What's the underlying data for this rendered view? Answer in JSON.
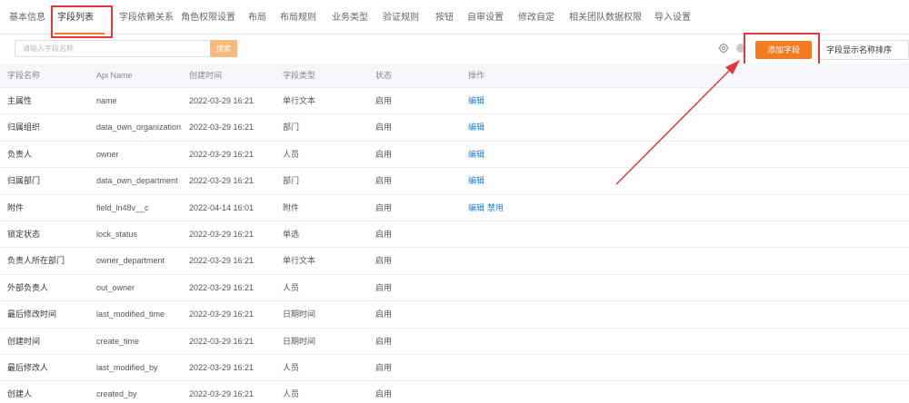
{
  "tabs": [
    {
      "label": "基本信息"
    },
    {
      "label": "字段列表"
    },
    {
      "label": "字段依赖关系"
    },
    {
      "label": "角色权限设置"
    },
    {
      "label": "布局"
    },
    {
      "label": "布局规则"
    },
    {
      "label": "业务类型"
    },
    {
      "label": "验证规则"
    },
    {
      "label": "按钮"
    },
    {
      "label": "自审设置"
    },
    {
      "label": "修改自定"
    },
    {
      "label": "相关团队数据权限"
    },
    {
      "label": "导入设置"
    }
  ],
  "active_tab": "字段列表",
  "toolbar": {
    "search_placeholder": "请输入字段名称",
    "search_button": "搜索",
    "add_field_button": "添加字段",
    "sort_button": "字段显示名称排序"
  },
  "icons": {
    "settings": "gear-icon",
    "info": "info-icon"
  },
  "colors": {
    "accent": "#f47b20",
    "link": "#1f7fd6",
    "annotation": "#e03a3a"
  },
  "table": {
    "headers": [
      "字段名称",
      "Api Name",
      "创建时间",
      "字段类型",
      "状态",
      "操作"
    ],
    "rows": [
      {
        "name": "主属性",
        "api": "name",
        "created": "2022-03-29 16:21",
        "type": "单行文本",
        "status": "启用",
        "ops": [
          "编辑"
        ]
      },
      {
        "name": "归属组织",
        "api": "data_own_organization",
        "created": "2022-03-29 16:21",
        "type": "部门",
        "status": "启用",
        "ops": [
          "编辑"
        ]
      },
      {
        "name": "负责人",
        "api": "owner",
        "created": "2022-03-29 16:21",
        "type": "人员",
        "status": "启用",
        "ops": [
          "编辑"
        ]
      },
      {
        "name": "归属部门",
        "api": "data_own_department",
        "created": "2022-03-29 16:21",
        "type": "部门",
        "status": "启用",
        "ops": [
          "编辑"
        ]
      },
      {
        "name": "附件",
        "api": "field_ln48v__c",
        "created": "2022-04-14 16:01",
        "type": "附件",
        "status": "启用",
        "ops": [
          "编辑",
          "禁用"
        ]
      },
      {
        "name": "锁定状态",
        "api": "lock_status",
        "created": "2022-03-29 16:21",
        "type": "单选",
        "status": "启用",
        "ops": []
      },
      {
        "name": "负责人所在部门",
        "api": "owner_department",
        "created": "2022-03-29 16:21",
        "type": "单行文本",
        "status": "启用",
        "ops": []
      },
      {
        "name": "外部负责人",
        "api": "out_owner",
        "created": "2022-03-29 16:21",
        "type": "人员",
        "status": "启用",
        "ops": []
      },
      {
        "name": "最后修改时间",
        "api": "last_modified_time",
        "created": "2022-03-29 16:21",
        "type": "日期时间",
        "status": "启用",
        "ops": []
      },
      {
        "name": "创建时间",
        "api": "create_time",
        "created": "2022-03-29 16:21",
        "type": "日期时间",
        "status": "启用",
        "ops": []
      },
      {
        "name": "最后修改人",
        "api": "last_modified_by",
        "created": "2022-03-29 16:21",
        "type": "人员",
        "status": "启用",
        "ops": []
      },
      {
        "name": "创建人",
        "api": "created_by",
        "created": "2022-03-29 16:21",
        "type": "人员",
        "status": "启用",
        "ops": []
      }
    ]
  }
}
